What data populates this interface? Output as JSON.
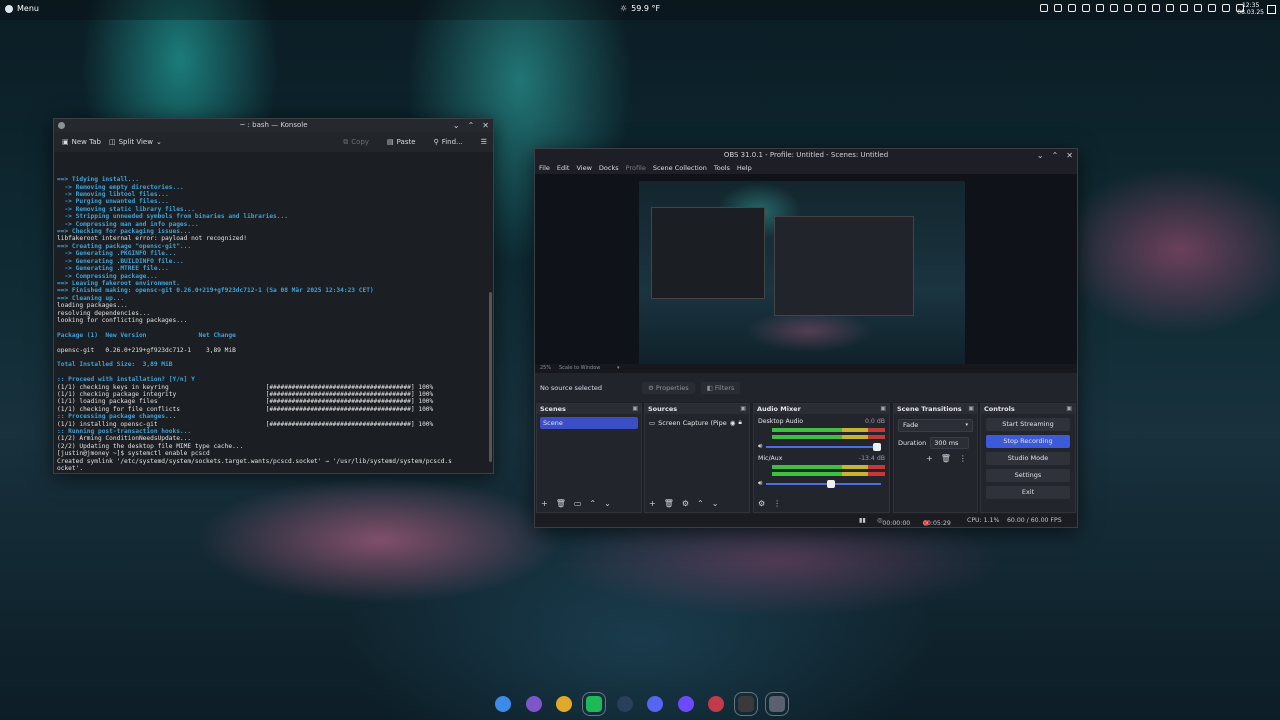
{
  "top_panel": {
    "menu_label": "Menu",
    "weather": "59.9 °F",
    "clock_time": "12:35",
    "clock_date": "08.03.25"
  },
  "konsole": {
    "title": "~ : bash — Konsole",
    "toolbar": {
      "new_tab": "New Tab",
      "split_view": "Split View",
      "copy": "Copy",
      "paste": "Paste",
      "find": "Find..."
    },
    "lines": [
      {
        "t": "==> Tidying install...",
        "c": "c-blue"
      },
      {
        "t": "  -> Removing empty directories...",
        "c": "c-blue"
      },
      {
        "t": "  -> Removing libtool files...",
        "c": "c-blue"
      },
      {
        "t": "  -> Purging unwanted files...",
        "c": "c-blue"
      },
      {
        "t": "  -> Removing static library files...",
        "c": "c-blue"
      },
      {
        "t": "  -> Stripping unneeded symbols from binaries and libraries...",
        "c": "c-blue"
      },
      {
        "t": "  -> Compressing man and info pages...",
        "c": "c-blue"
      },
      {
        "t": "==> Checking for packaging issues...",
        "c": "c-blue"
      },
      {
        "t": "libfakeroot internal error: payload not recognized!",
        "c": "c-white"
      },
      {
        "t": "==> Creating package \"opensc-git\"...",
        "c": "c-blue"
      },
      {
        "t": "  -> Generating .PKGINFO file...",
        "c": "c-blue"
      },
      {
        "t": "  -> Generating .BUILDINFO file...",
        "c": "c-blue"
      },
      {
        "t": "  -> Generating .MTREE file...",
        "c": "c-blue"
      },
      {
        "t": "  -> Compressing package...",
        "c": "c-blue"
      },
      {
        "t": "==> Leaving fakeroot environment.",
        "c": "c-blue"
      },
      {
        "t": "==> Finished making: opensc-git 0.26.0+219+gf923dc712-1 (Sa 08 Mär 2025 12:34:23 CET)",
        "c": "c-blue"
      },
      {
        "t": "==> Cleaning up...",
        "c": "c-blue"
      },
      {
        "t": "loading packages...",
        "c": "c-white"
      },
      {
        "t": "resolving dependencies...",
        "c": "c-white"
      },
      {
        "t": "looking for conflicting packages...",
        "c": "c-white"
      },
      {
        "t": " ",
        "c": "c-white"
      },
      {
        "t": "Package (1)  New Version              Net Change",
        "c": "c-blue"
      },
      {
        "t": " ",
        "c": "c-white"
      },
      {
        "t": "opensc-git   0.26.0+219+gf923dc712-1    3,89 MiB",
        "c": "c-white"
      },
      {
        "t": " ",
        "c": "c-white"
      },
      {
        "t": "Total Installed Size:  3,89 MiB",
        "c": "c-blue"
      },
      {
        "t": " ",
        "c": "c-white"
      },
      {
        "t": ":: Proceed with installation? [Y/n] Y",
        "c": "c-blue"
      },
      {
        "t": "(1/1) checking keys in keyring                          [######################################] 100%",
        "c": "c-white"
      },
      {
        "t": "(1/1) checking package integrity                        [######################################] 100%",
        "c": "c-white"
      },
      {
        "t": "(1/1) loading package files                             [######################################] 100%",
        "c": "c-white"
      },
      {
        "t": "(1/1) checking for file conflicts                       [######################################] 100%",
        "c": "c-white"
      },
      {
        "t": ":: Processing package changes...",
        "c": "c-blue"
      },
      {
        "t": "(1/1) installing opensc-git                             [######################################] 100%",
        "c": "c-white"
      },
      {
        "t": ":: Running post-transaction hooks...",
        "c": "c-blue"
      },
      {
        "t": "(1/2) Arming ConditionNeedsUpdate...",
        "c": "c-white"
      },
      {
        "t": "(2/2) Updating the desktop file MIME type cache...",
        "c": "c-white"
      },
      {
        "t": "[justin@jmoney ~]$ systemctl enable pcscd",
        "c": "c-white"
      },
      {
        "t": "Created symlink '/etc/systemd/system/sockets.target.wants/pcscd.socket' → '/usr/lib/systemd/system/pcscd.s",
        "c": "c-white"
      },
      {
        "t": "ocket'.",
        "c": "c-white"
      },
      {
        "t": "[justin@jmoney ~]$ systemctl start pcscd",
        "c": "c-white"
      },
      {
        "t": "[justin@jmoney ~]$ ▮",
        "c": "c-white"
      }
    ]
  },
  "obs": {
    "title": "OBS 31.0.1 - Profile: Untitled - Scenes: Untitled",
    "menu": [
      "File",
      "Edit",
      "View",
      "Docks",
      "Profile",
      "Scene Collection",
      "Tools",
      "Help"
    ],
    "zoom": "25%",
    "scale_mode": "Scale to Window",
    "no_source": "No source selected",
    "properties": "Properties",
    "filters": "Filters",
    "docks": {
      "scenes": {
        "title": "Scenes",
        "items": [
          "Scene"
        ]
      },
      "sources": {
        "title": "Sources",
        "items": [
          "Screen Capture (Pipe"
        ]
      },
      "mixer": {
        "title": "Audio Mixer",
        "channels": [
          {
            "name": "Desktop Audio",
            "db": "0.0 dB",
            "volume": 1.0
          },
          {
            "name": "Mic/Aux",
            "db": "-13.4 dB",
            "volume": 0.6
          }
        ]
      },
      "transitions": {
        "title": "Scene Transitions",
        "selected": "Fade",
        "duration_label": "Duration",
        "duration": "300 ms"
      },
      "controls": {
        "title": "Controls",
        "buttons": [
          "Start Streaming",
          "Stop Recording",
          "Studio Mode",
          "Settings",
          "Exit"
        ]
      }
    },
    "status": {
      "stream_time": "00:00:00",
      "rec_time": "00:05:29",
      "cpu": "CPU: 1.1%",
      "fps": "60.00 / 60.00 FPS"
    }
  },
  "taskbar": {
    "icons": [
      {
        "name": "finder-icon",
        "color": "#3d8be8"
      },
      {
        "name": "browser-icon",
        "color": "#7e56c9"
      },
      {
        "name": "chrome-icon",
        "color": "#e0a92a"
      },
      {
        "name": "spotify-icon",
        "color": "#1db954"
      },
      {
        "name": "steam-icon",
        "color": "#2a3f5a"
      },
      {
        "name": "discord-icon",
        "color": "#5865f2"
      },
      {
        "name": "proton-icon",
        "color": "#6d4aff"
      },
      {
        "name": "app-red-icon",
        "color": "#c23b4a"
      },
      {
        "name": "obs-icon",
        "color": "#3a3a3a"
      },
      {
        "name": "konsole-icon",
        "color": "#5a6070"
      }
    ]
  }
}
